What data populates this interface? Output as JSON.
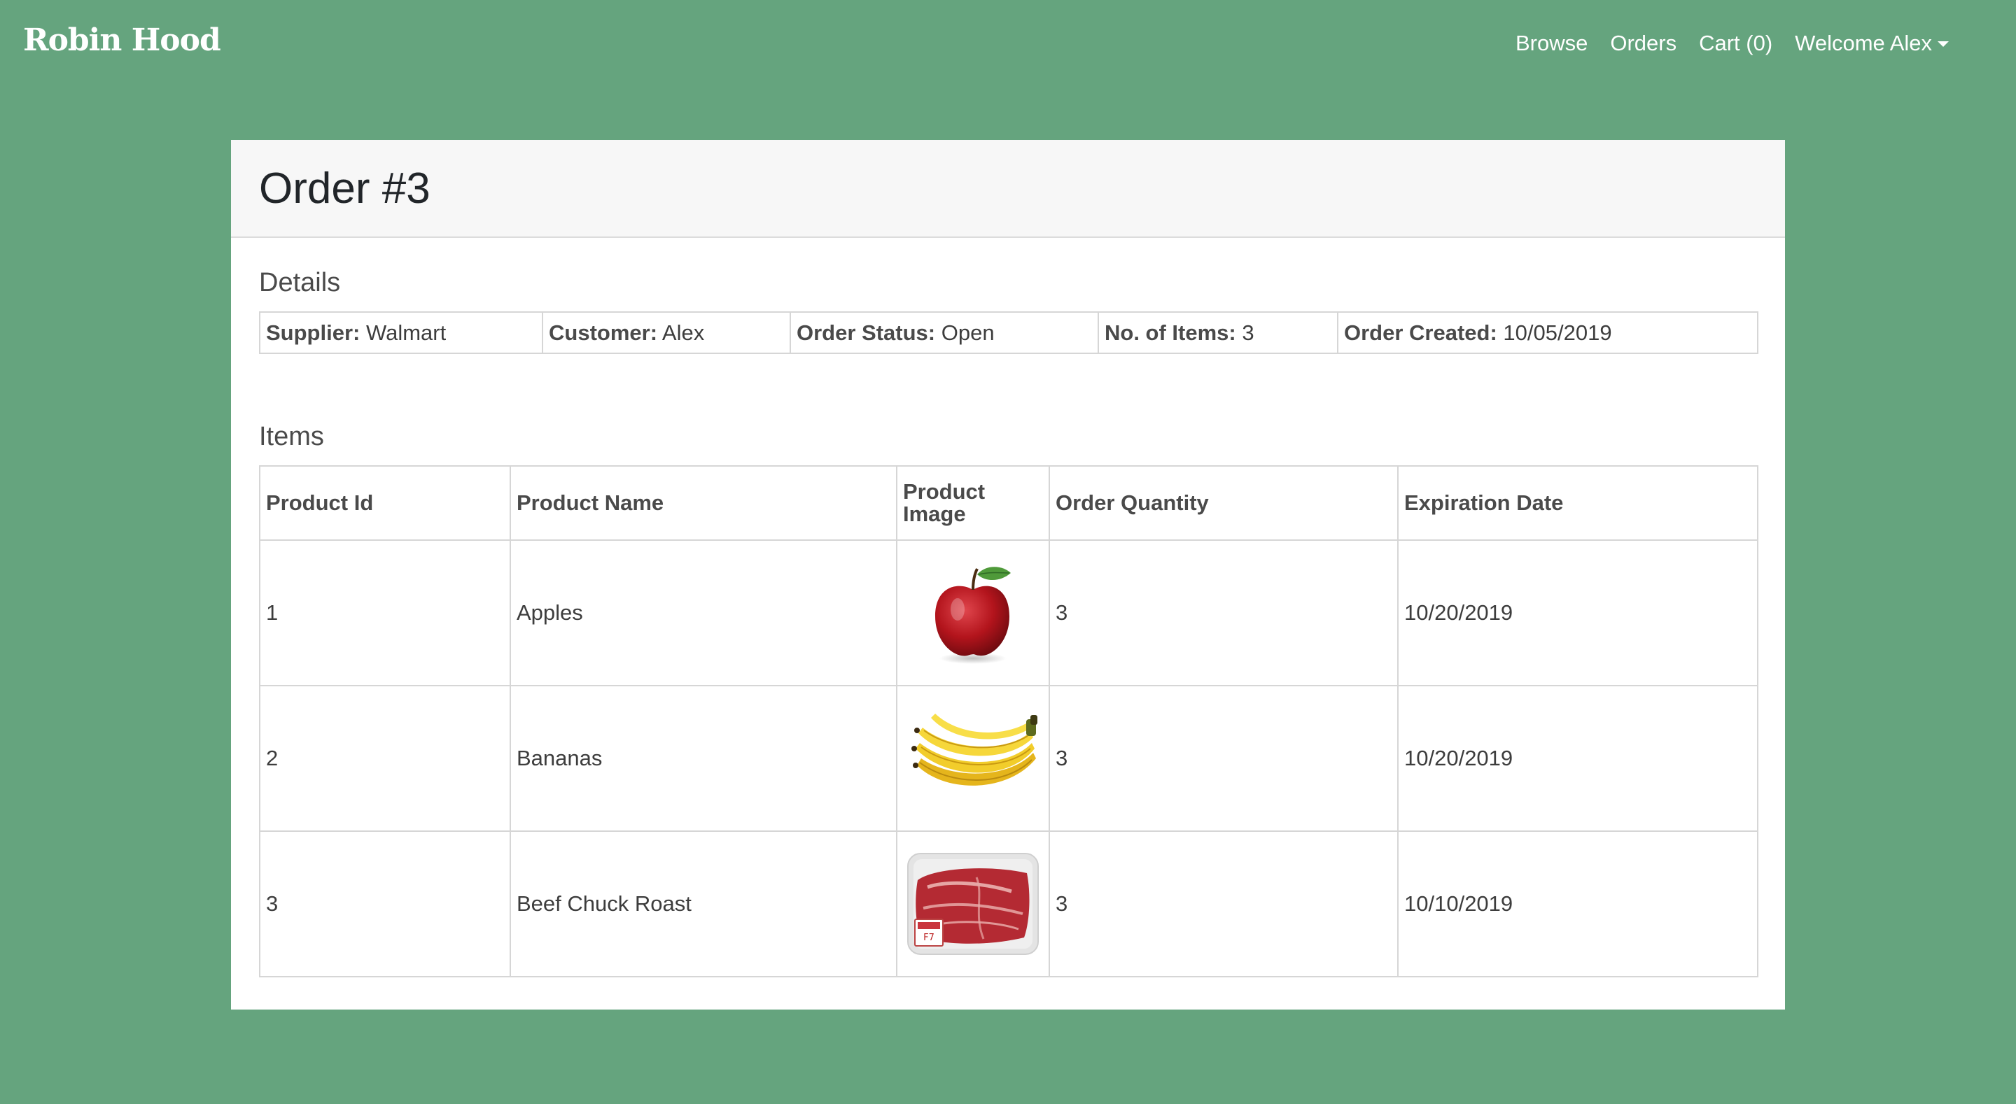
{
  "navbar": {
    "brand": "Robin Hood",
    "links": {
      "browse": "Browse",
      "orders": "Orders",
      "cart": "Cart (0)",
      "welcome": "Welcome Alex"
    }
  },
  "order": {
    "title": "Order #3",
    "details_heading": "Details",
    "details": {
      "supplier_label": "Supplier:",
      "supplier_value": "Walmart",
      "customer_label": "Customer:",
      "customer_value": "Alex",
      "status_label": "Order Status:",
      "status_value": "Open",
      "items_label": "No. of Items:",
      "items_value": "3",
      "created_label": "Order Created:",
      "created_value": "10/05/2019"
    },
    "items_heading": "Items",
    "columns": {
      "id": "Product Id",
      "name": "Product Name",
      "image_line1": "Product",
      "image_line2": "Image",
      "quantity": "Order Quantity",
      "expiration": "Expiration Date"
    },
    "rows": [
      {
        "id": "1",
        "name": "Apples",
        "image": "apple-image",
        "quantity": "3",
        "expiration": "10/20/2019"
      },
      {
        "id": "2",
        "name": "Bananas",
        "image": "bananas-image",
        "quantity": "3",
        "expiration": "10/20/2019"
      },
      {
        "id": "3",
        "name": "Beef Chuck Roast",
        "image": "beef-chuck-roast-image",
        "quantity": "3",
        "expiration": "10/10/2019"
      }
    ]
  },
  "colors": {
    "background": "#65a47e",
    "header_bg": "#f7f7f7",
    "border": "#d6d6d6"
  }
}
